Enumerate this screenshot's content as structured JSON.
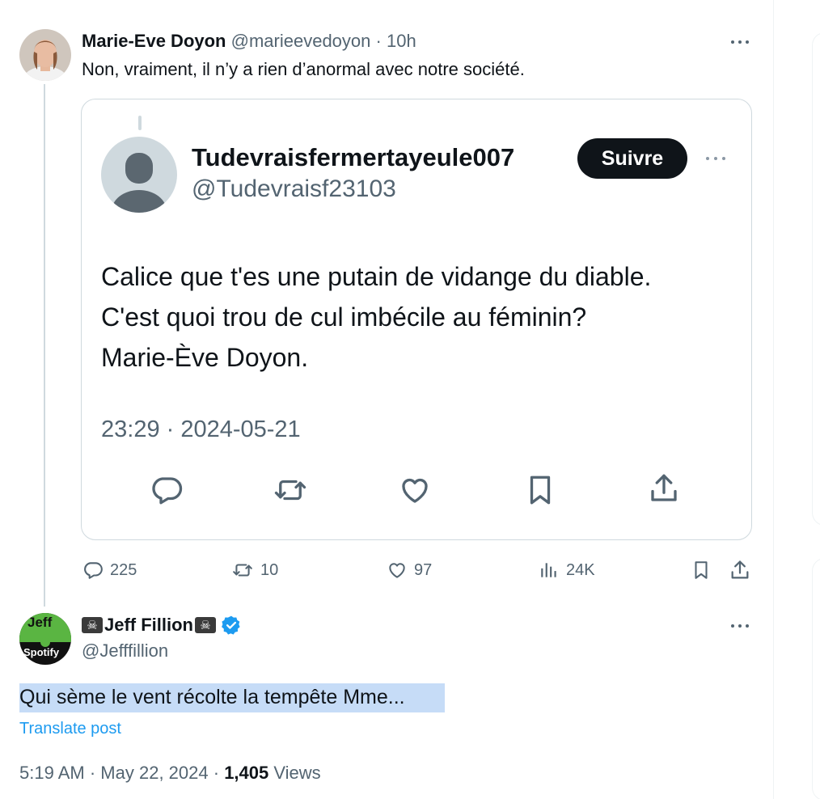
{
  "original_tweet": {
    "author_name": "Marie-Eve Doyon",
    "handle": "@marieevedoyon",
    "separator": "·",
    "time_ago": "10h",
    "text": "Non, vraiment, il n’y a rien d’anormal avec notre société.",
    "stats": {
      "replies": "225",
      "reposts": "10",
      "likes": "97",
      "views": "24K"
    }
  },
  "quoted_screenshot": {
    "display_name": "Tudevraisfermertayeule007",
    "handle": "@Tudevraisf23103",
    "follow_label": "Suivre",
    "text_line1": "Calice que t'es une putain de vidange du diable.",
    "text_line2": "C'est quoi trou de cul imbécile au féminin?",
    "text_line3": "Marie-Ève Doyon.",
    "timestamp": "23:29 · 2024-05-21"
  },
  "reply_tweet": {
    "avatar_text_top": "Jeff",
    "avatar_text_bottom": "Spotify",
    "name_prefix_emoji": "☠",
    "author_name": "Jeff Fillion",
    "name_suffix_emoji": "☠",
    "verified": true,
    "handle": "@Jefffillion",
    "text": "Qui sème le vent récolte la tempête Mme...",
    "translate_label": "Translate post",
    "time": "5:19 AM",
    "separator": "·",
    "date": "May 22, 2024",
    "views_count": "1,405",
    "views_label": "Views"
  },
  "colors": {
    "text": "#0f1419",
    "muted": "#536471",
    "link": "#1d9bf0",
    "highlight": "#c6dcf7",
    "border": "#cfd9de",
    "verified": "#1d9bf0"
  },
  "icons": [
    "reply-icon",
    "repost-icon",
    "like-icon",
    "bookmark-icon",
    "share-icon",
    "views-icon",
    "verified-badge-icon",
    "more-icon",
    "skull-icon"
  ]
}
